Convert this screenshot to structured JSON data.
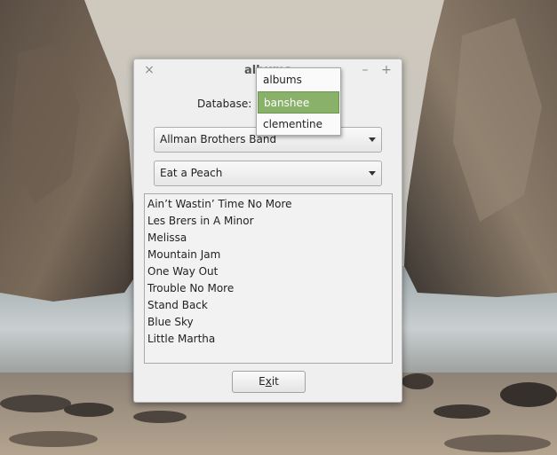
{
  "window": {
    "title": "albums",
    "close_glyph": "×",
    "minimize_glyph": "–",
    "maximize_glyph": "+"
  },
  "database": {
    "label": "Database:",
    "options": [
      "albums",
      "banshee",
      "clementine"
    ],
    "selected": "banshee"
  },
  "artist_combo": {
    "value": "Allman Brothers Band"
  },
  "album_combo": {
    "value": "Eat a Peach"
  },
  "tracks": [
    "Ain’t Wastin’ Time No More",
    "Les Brers in A Minor",
    "Melissa",
    "Mountain Jam",
    "One Way Out",
    "Trouble No More",
    "Stand Back",
    "Blue Sky",
    "Little Martha"
  ],
  "exit_button": {
    "pre": "E",
    "mnemonic": "x",
    "post": "it"
  },
  "icons": {
    "close": "close-icon",
    "minimize": "minimize-icon",
    "maximize": "maximize-icon",
    "dropdown": "chevron-down-icon"
  },
  "colors": {
    "selection": "#8ab16a",
    "window_bg": "#efefef"
  }
}
